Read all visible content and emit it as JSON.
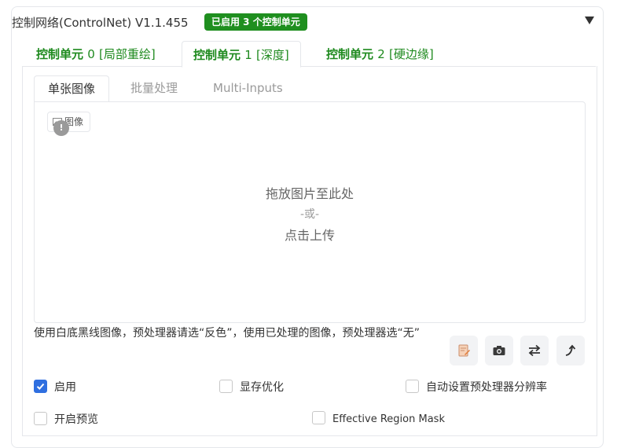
{
  "header": {
    "title": "控制网络(ControlNet) V1.1.455",
    "badge": "已启用 3 个控制单元"
  },
  "unit_tabs": [
    {
      "name": "控制单元",
      "num": "0",
      "suffix": "[局部重绘]",
      "active": false
    },
    {
      "name": "控制单元",
      "num": "1",
      "suffix": "[深度]",
      "active": true
    },
    {
      "name": "控制单元",
      "num": "2",
      "suffix": "[硬边缘]",
      "active": false
    }
  ],
  "sub_tabs": [
    {
      "label": "单张图像",
      "active": true
    },
    {
      "label": "批量处理",
      "active": false
    },
    {
      "label": "Multi-Inputs",
      "active": false
    }
  ],
  "drop_zone": {
    "chip_label": "图像",
    "drag_text": "拖放图片至此处",
    "or_text": "-或-",
    "click_text": "点击上传"
  },
  "note": "使用白底黑线图像，预处理器请选“反色”，使用已处理的图像，预处理器选“无”",
  "tool_buttons": [
    "edit-icon",
    "camera-icon",
    "swap-icon",
    "send-up-icon"
  ],
  "options": {
    "enable": {
      "label": "启用",
      "checked": true
    },
    "low_vram": {
      "label": "显存优化",
      "checked": false
    },
    "pixel_perfect": {
      "label": "自动设置预处理器分辨率",
      "checked": false
    },
    "preview": {
      "label": "开启预览",
      "checked": false
    },
    "effective_mask": {
      "label": "Effective Region Mask",
      "checked": false
    }
  },
  "colors": {
    "accent_green": "#1e8a1e",
    "badge_green": "#1f8f1f",
    "checkbox_blue": "#2f6fe0"
  }
}
